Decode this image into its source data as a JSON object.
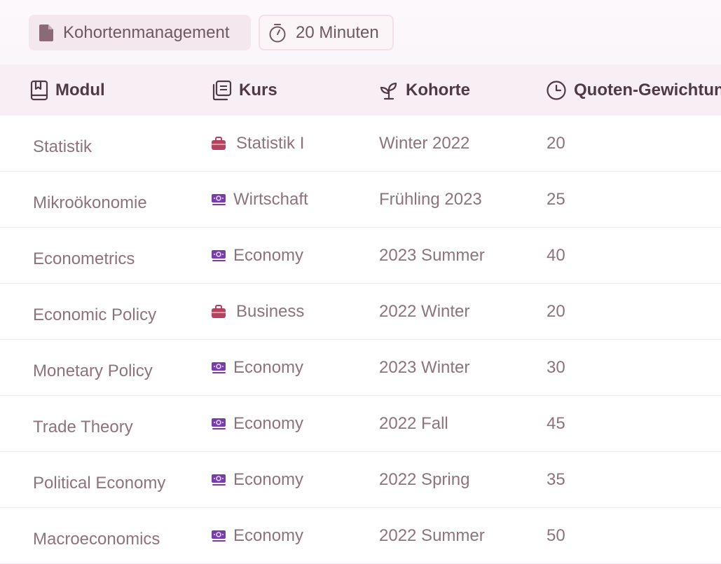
{
  "toolbar": {
    "doc_chip_label": "Kohortenmanagement",
    "timer_chip_label": "20 Minuten"
  },
  "table": {
    "columns": [
      {
        "label": "Modul",
        "icon": "book-icon"
      },
      {
        "label": "Kurs",
        "icon": "library-icon"
      },
      {
        "label": "Kohorte",
        "icon": "sprout-icon"
      },
      {
        "label": "Quoten-Gewichtung",
        "icon": "clock-icon"
      }
    ],
    "rows": [
      {
        "modul": "Statistik",
        "kurs": "Statistik I",
        "kurs_icon": "briefcase-icon",
        "kohorte": "Winter 2022",
        "quote": "20"
      },
      {
        "modul": "Mikroökonomie",
        "kurs": "Wirtschaft",
        "kurs_icon": "money-icon",
        "kohorte": "Frühling 2023",
        "quote": "25"
      },
      {
        "modul": "Econometrics",
        "kurs": "Economy",
        "kurs_icon": "money-icon",
        "kohorte": "2023 Summer",
        "quote": "40"
      },
      {
        "modul": "Economic Policy",
        "kurs": "Business",
        "kurs_icon": "briefcase-icon",
        "kohorte": "2022 Winter",
        "quote": "20"
      },
      {
        "modul": "Monetary Policy",
        "kurs": "Economy",
        "kurs_icon": "money-icon",
        "kohorte": "2023 Winter",
        "quote": "30"
      },
      {
        "modul": "Trade Theory",
        "kurs": "Economy",
        "kurs_icon": "money-icon",
        "kohorte": "2022 Fall",
        "quote": "45"
      },
      {
        "modul": "Political Economy",
        "kurs": "Economy",
        "kurs_icon": "money-icon",
        "kohorte": "2022 Spring",
        "quote": "35"
      },
      {
        "modul": "Macroeconomics",
        "kurs": "Economy",
        "kurs_icon": "money-icon",
        "kohorte": "2022 Summer",
        "quote": "50"
      }
    ]
  },
  "colors": {
    "briefcase": "#b4435e",
    "money": "#7a3da8",
    "header_bg": "#f8eff5",
    "chip_bg": "#f4e8ee"
  }
}
